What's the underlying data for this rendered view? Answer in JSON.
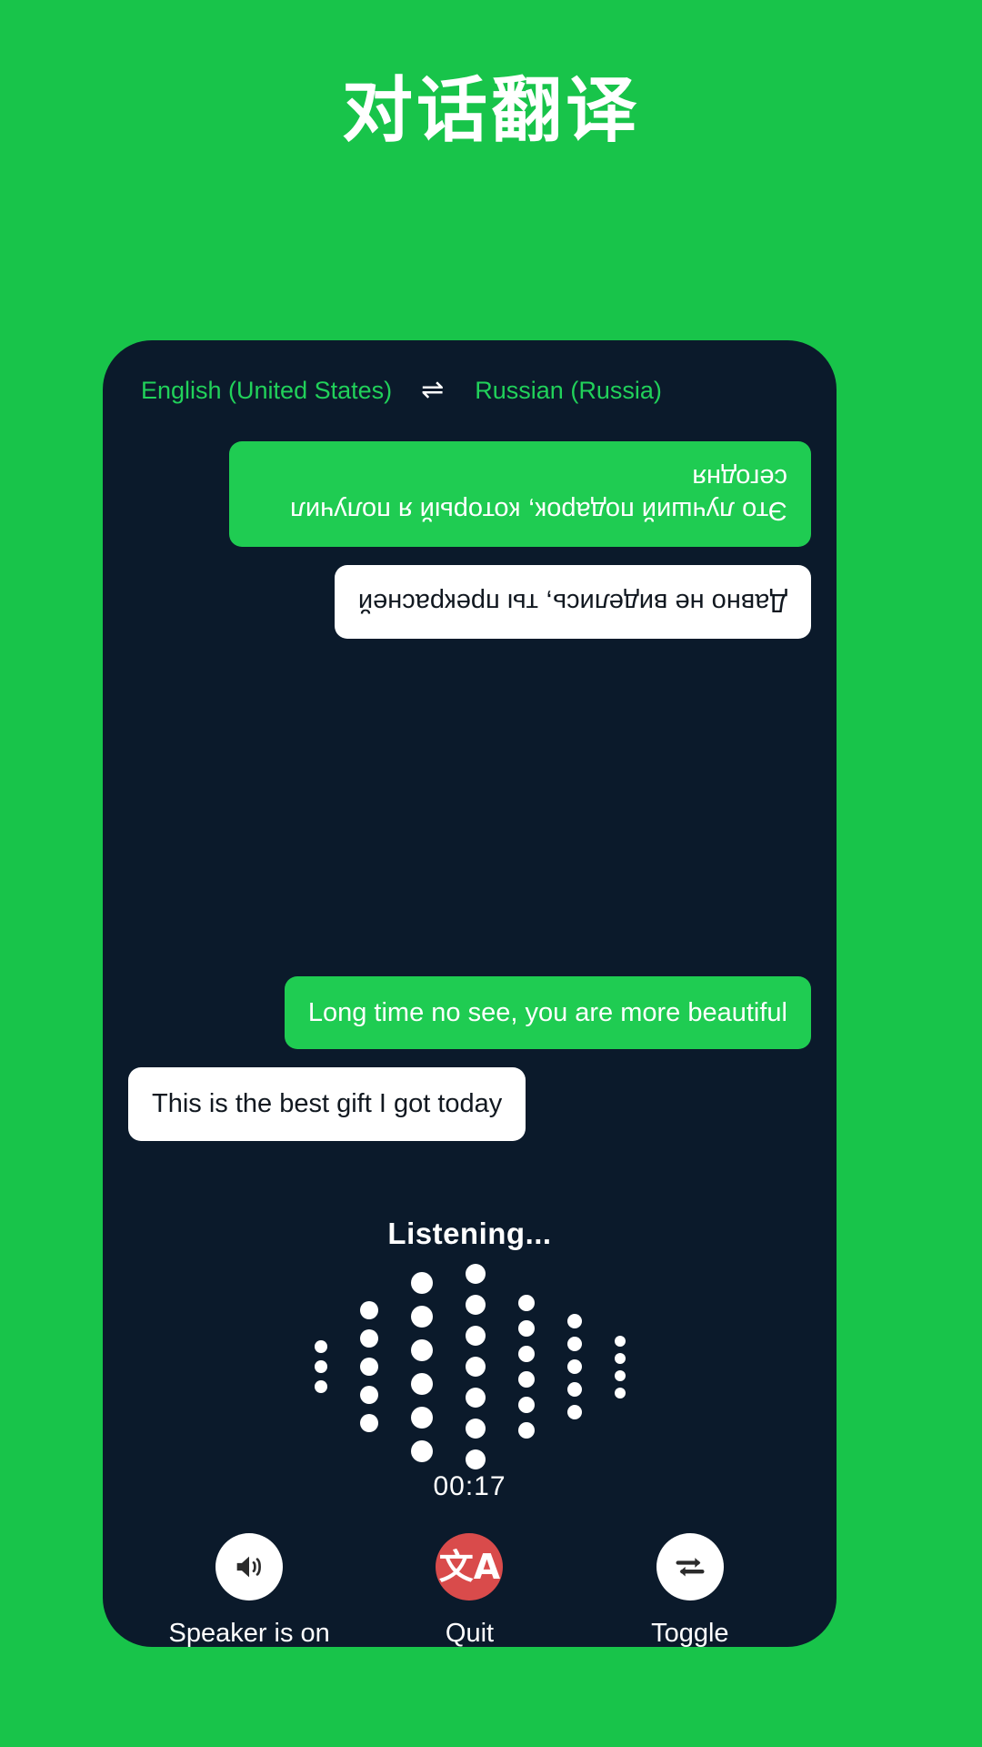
{
  "header": {
    "title": "对话翻译"
  },
  "languages": {
    "source": "English (United States)",
    "target": "Russian (Russia)",
    "swap_icon": "swap-horizontal-icon",
    "swap_glyph": "⇌"
  },
  "conversation": {
    "remote_pane": {
      "rotated": true,
      "messages": [
        {
          "text": "Это лучший подарок, который я получил сегодня",
          "style": "green",
          "align": "right"
        },
        {
          "text": "Давно не виделись, ты прекрасней",
          "style": "white",
          "align": "right"
        }
      ]
    },
    "local_pane": {
      "rotated": false,
      "messages": [
        {
          "text": "Long time no see, you are more beautiful",
          "style": "green",
          "align": "right"
        },
        {
          "text": "This is the best gift I got today",
          "style": "white",
          "align": "left"
        }
      ]
    }
  },
  "listening": {
    "status": "Listening...",
    "timer": "00:17",
    "waveform": [
      {
        "count": 3,
        "size": 14
      },
      {
        "count": 5,
        "size": 20
      },
      {
        "count": 6,
        "size": 24
      },
      {
        "count": 7,
        "size": 22
      },
      {
        "count": 6,
        "size": 18
      },
      {
        "count": 5,
        "size": 16
      },
      {
        "count": 4,
        "size": 12
      }
    ]
  },
  "controls": [
    {
      "label": "Speaker is on",
      "icon": "speaker-on-icon",
      "circle_style": "light"
    },
    {
      "label": "Quit",
      "icon": "translate-icon",
      "circle_style": "danger",
      "glyph": "文A"
    },
    {
      "label": "Toggle",
      "icon": "swap-repeat-icon",
      "circle_style": "light"
    }
  ],
  "colors": {
    "background_green": "#18c44a",
    "phone_dark": "#0b1a2b",
    "bubble_green": "#1fcc52",
    "bubble_white": "#ffffff",
    "accent_green_text": "#21d15a",
    "quit_red": "#d94b4b",
    "divider": "#5b6c7d"
  }
}
